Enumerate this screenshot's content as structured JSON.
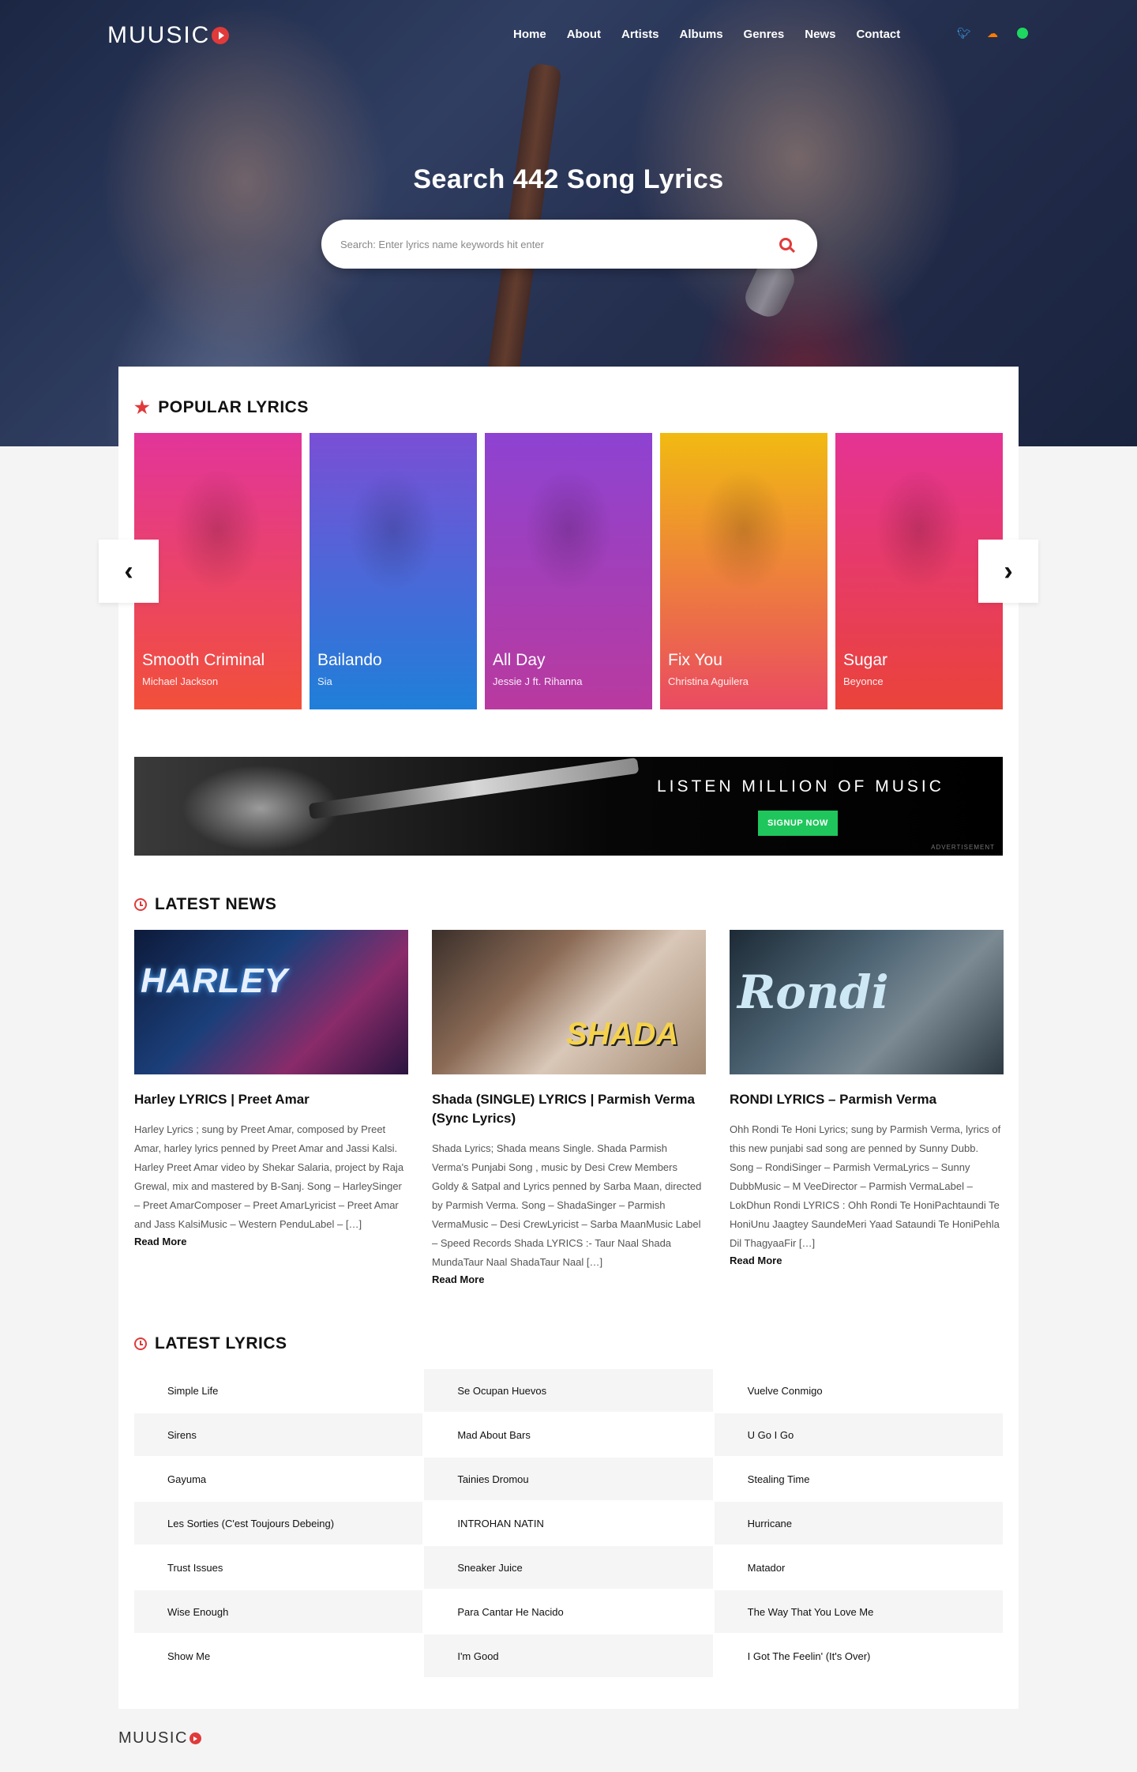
{
  "site": {
    "logo": "MUUSIC"
  },
  "nav": [
    "Home",
    "About",
    "Artists",
    "Albums",
    "Genres",
    "News",
    "Contact"
  ],
  "social": [
    "twitter-icon",
    "soundcloud-icon",
    "spotify-icon"
  ],
  "hero": {
    "title": "Search 442 Song Lyrics",
    "search_placeholder": "Search: Enter lyrics name keywords hit enter"
  },
  "popular": {
    "heading": "POPULAR LYRICS",
    "cards": [
      {
        "title": "Smooth Criminal",
        "artist": "Michael Jackson",
        "color_top": "#e2359a",
        "color_bottom": "#f2503a"
      },
      {
        "title": "Bailando",
        "artist": "Sia",
        "color_top": "#7a4fd6",
        "color_bottom": "#1f7fd9"
      },
      {
        "title": "All Day",
        "artist": "Jessie J ft. Rihanna",
        "color_top": "#8d43d2",
        "color_bottom": "#b93a9f"
      },
      {
        "title": "Fix You",
        "artist": "Christina Aguilera",
        "color_top": "#f1ba12",
        "color_bottom": "#ea4a62"
      },
      {
        "title": "Sugar",
        "artist": "Beyonce",
        "color_top": "#e43394",
        "color_bottom": "#ea4339"
      }
    ]
  },
  "ad": {
    "title": "LISTEN MILLION OF MUSIC",
    "button": "SIGNUP NOW",
    "note": "ADVERTISEMENT"
  },
  "news": {
    "heading": "LATEST NEWS",
    "items": [
      {
        "title": "Harley LYRICS | Preet Amar",
        "text": "Harley Lyrics ; sung by Preet Amar, composed by Preet Amar, harley lyrics penned by Preet Amar and Jassi Kalsi. Harley Preet Amar video by Shekar Salaria, project by Raja Grewal, mix and mastered by B-Sanj. Song – HarleySinger – Preet AmarComposer – Preet AmarLyricist – Preet Amar and Jass KalsiMusic – Western PenduLabel – […]",
        "read_more": "Read More",
        "image_text": "HARLEY"
      },
      {
        "title": "Shada (SINGLE) LYRICS | Parmish Verma (Sync Lyrics)",
        "text": "Shada Lyrics; Shada means Single. Shada Parmish Verma's Punjabi Song , music by Desi Crew Members Goldy & Satpal and Lyrics penned by Sarba Maan, directed by Parmish Verma. Song – ShadaSinger – Parmish VermaMusic – Desi CrewLyricist – Sarba MaanMusic Label – Speed Records Shada LYRICS :- Taur Naal Shada MundaTaur Naal ShadaTaur Naal […]",
        "read_more": "Read More",
        "image_text": "SHADA"
      },
      {
        "title": "RONDI LYRICS – Parmish Verma",
        "text": "Ohh Rondi Te Honi Lyrics; sung by Parmish Verma, lyrics of this new punjabi sad song are penned by Sunny Dubb. Song – RondiSinger – Parmish VermaLyrics – Sunny DubbMusic – M VeeDirector – Parmish VermaLabel – LokDhun Rondi LYRICS : Ohh Rondi Te HoniPachtaundi Te HoniUnu Jaagtey SaundeMeri Yaad Sataundi Te HoniPehla Dil ThagyaaFir […]",
        "read_more": "Read More",
        "image_text": "Rondi"
      }
    ]
  },
  "lyrics": {
    "heading": "LATEST LYRICS",
    "items": [
      "Simple Life",
      "Se Ocupan Huevos",
      "Vuelve Conmigo",
      "Sirens",
      "Mad About Bars",
      "U Go I Go",
      "Gayuma",
      "Tainies Dromou",
      "Stealing Time",
      "Les Sorties (C'est Toujours Debeing)",
      "INTROHAN NATIN",
      "Hurricane",
      "Trust Issues",
      "Sneaker Juice",
      "Matador",
      "Wise Enough",
      "Para Cantar He Nacido",
      "The Way That You Love Me",
      "Show Me",
      "I'm Good",
      "I Got The Feelin' (It's Over)"
    ]
  },
  "footer": {
    "logo": "MUUSIC"
  }
}
